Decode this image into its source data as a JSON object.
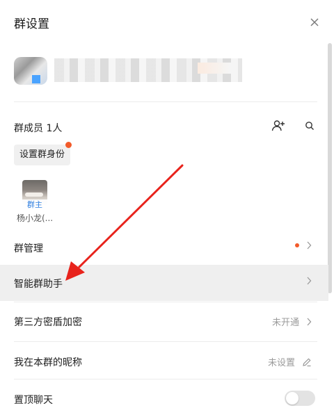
{
  "header": {
    "title": "群设置"
  },
  "members": {
    "label": "群成员 1人",
    "set_role_label": "设置群身份",
    "list": [
      {
        "role": "群主",
        "name": "杨小龙(..."
      }
    ]
  },
  "rows": {
    "manage": {
      "label": "群管理"
    },
    "assistant": {
      "label": "智能群助手"
    },
    "encryption": {
      "label": "第三方密盾加密",
      "value": "未开通"
    },
    "nickname": {
      "label": "我在本群的昵称",
      "value": "未设置"
    },
    "pin": {
      "label": "置顶聊天",
      "enabled": false
    }
  },
  "colors": {
    "accent_dot": "#f25b2a",
    "role_text": "#2f7fe0",
    "arrow": "#e8231c"
  }
}
